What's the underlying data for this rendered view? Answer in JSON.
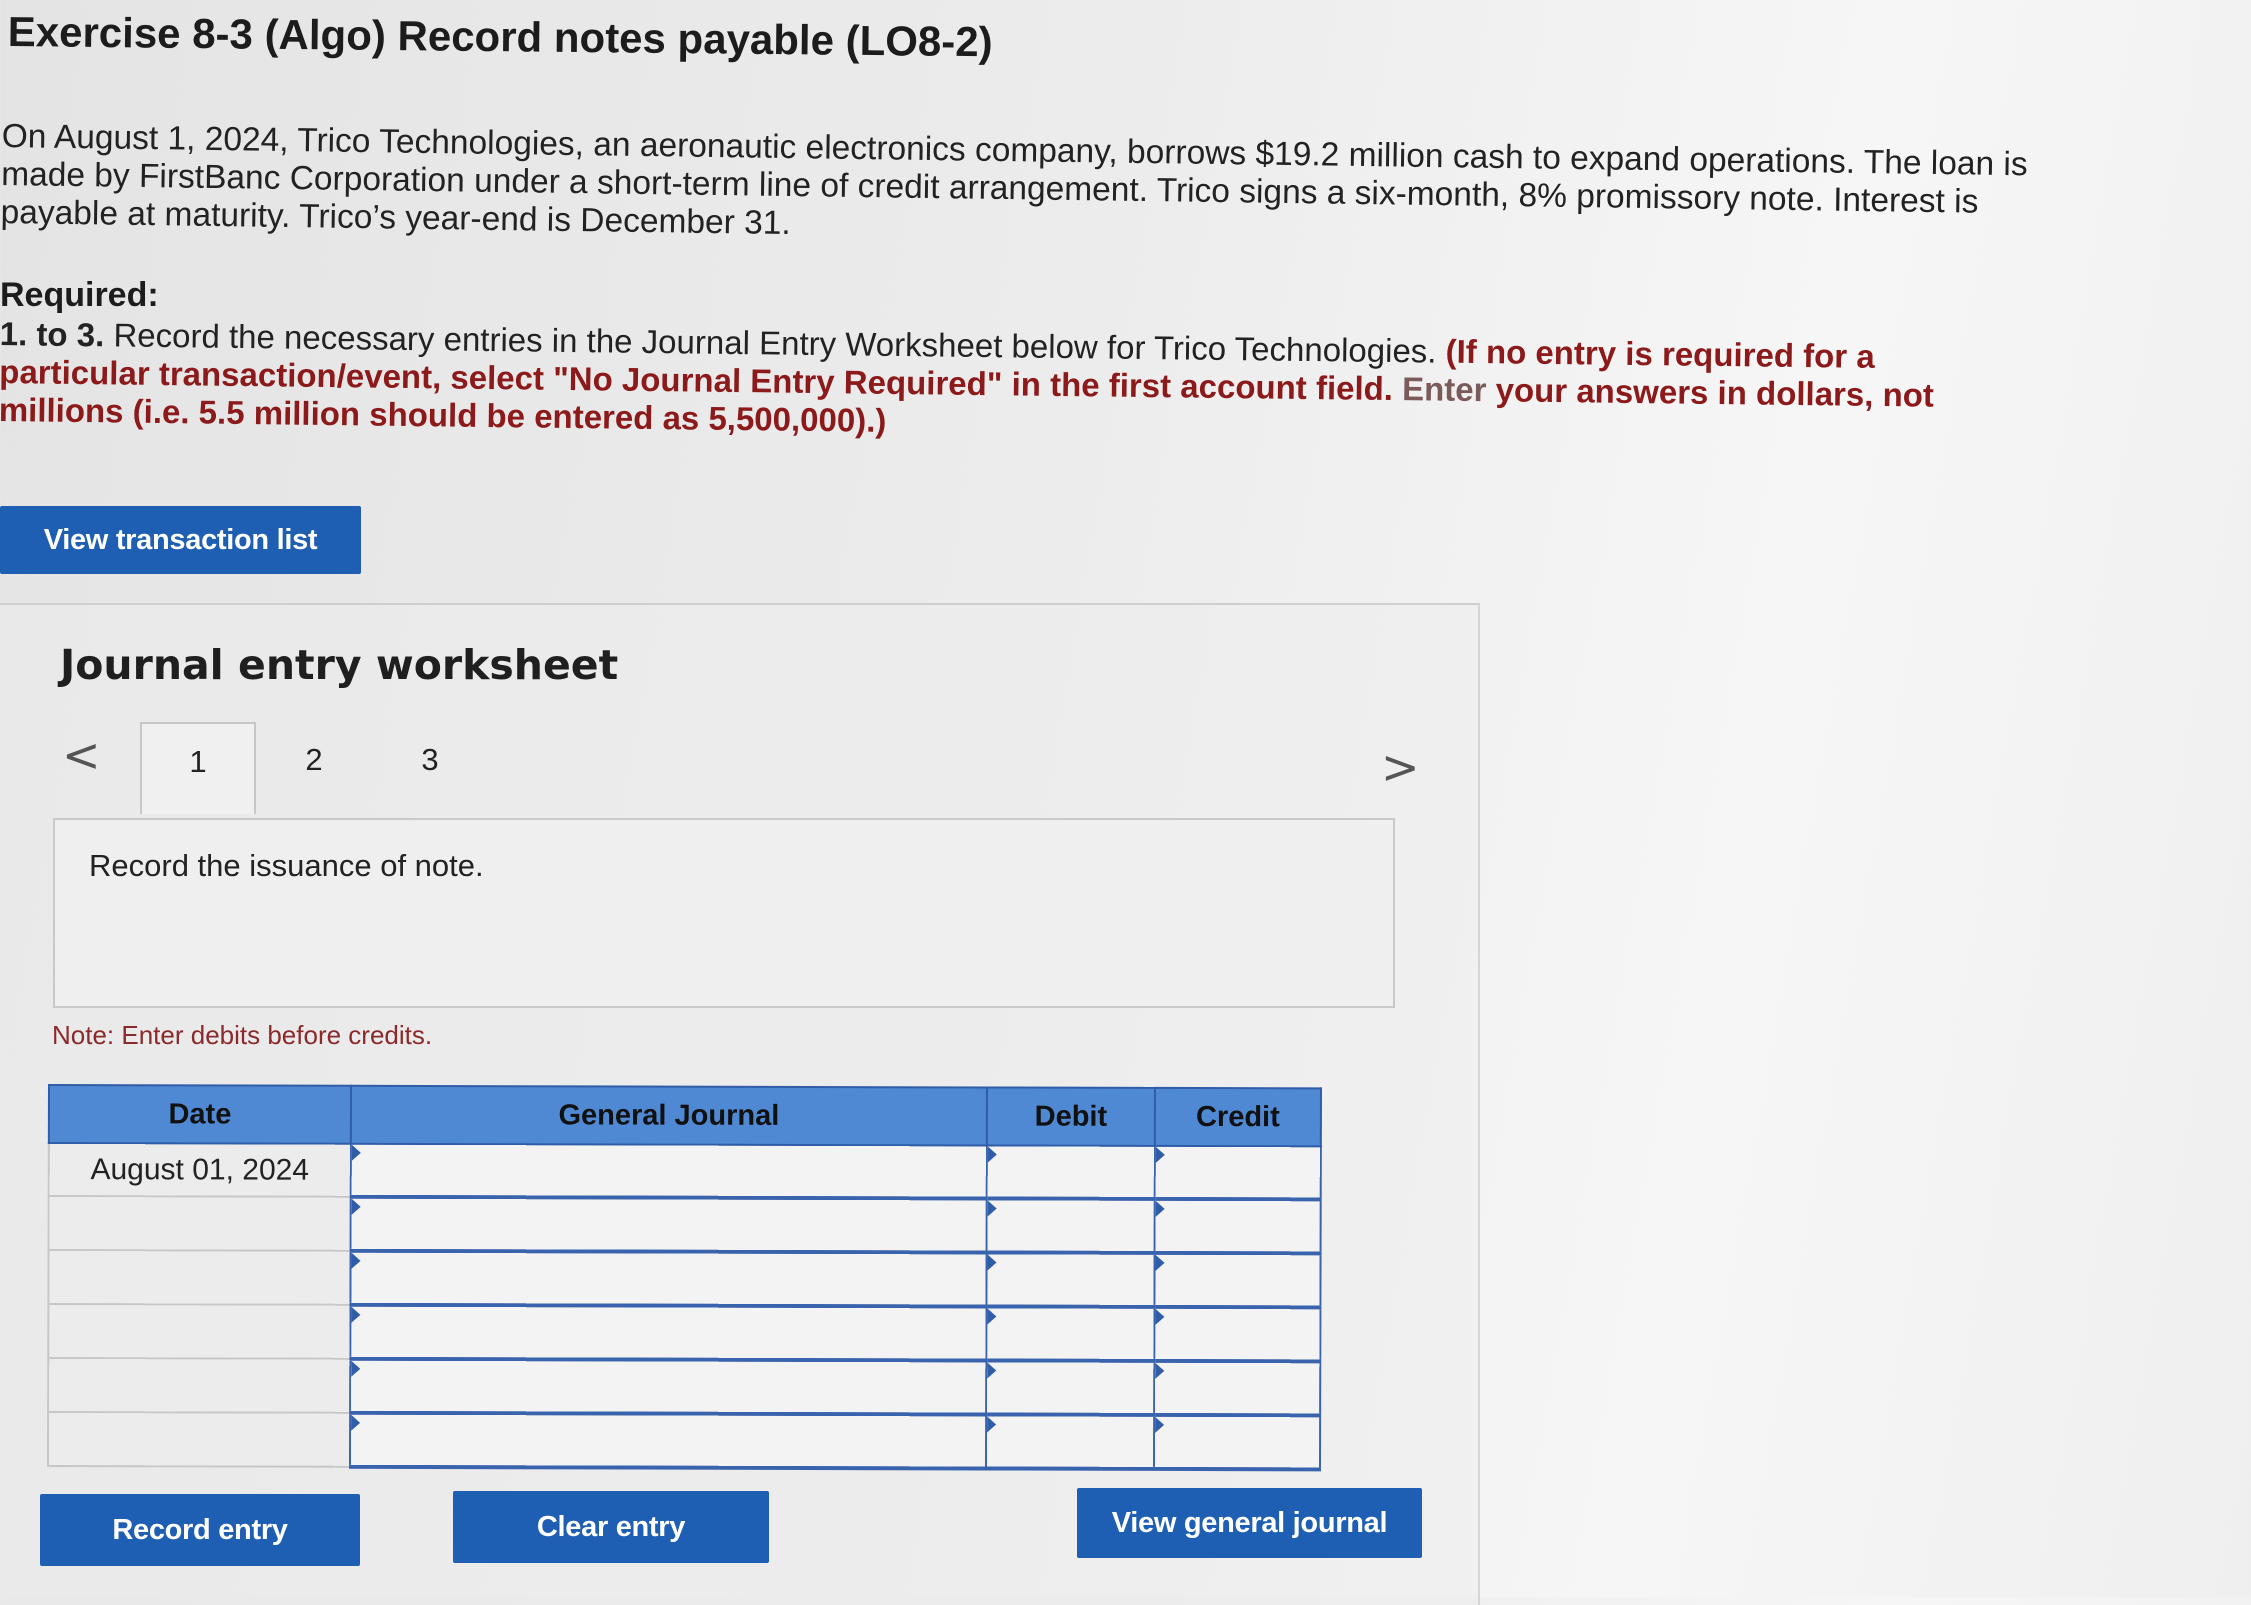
{
  "page": {
    "title": "Exercise 8-3 (Algo) Record notes payable (LO8-2)",
    "problem_text": "On August 1, 2024, Trico Technologies, an aeronautic electronics company, borrows $19.2 million cash to expand operations. The loan is made by FirstBanc Corporation under a short-term line of credit arrangement. Trico signs a six-month, 8% promissory note. Interest is payable at maturity. Trico’s year-end is December 31.",
    "required_label": "Required:",
    "instructions": {
      "prefix_bold": "1. to 3.",
      "main": " Record the necessary entries in the Journal Entry Worksheet below for Trico Technologies. ",
      "red": "(If no entry is required for a particular transaction/event, select \"No Journal Entry Required\" in the first account field. ",
      "faded": "Enter",
      "red_tail": " your answers in dollars, not millions (i.e. 5.5 million should be entered as 5,500,000).)"
    }
  },
  "buttons": {
    "view_transaction_list": "View transaction list",
    "record_entry": "Record entry",
    "clear_entry": "Clear entry",
    "view_general_journal": "View general journal"
  },
  "worksheet": {
    "heading": "Journal entry worksheet",
    "nav_prev": "<",
    "nav_next": ">",
    "tabs": [
      "1",
      "2",
      "3"
    ],
    "active_tab": "1",
    "task_text": "Record the issuance of note.",
    "note": "Note: Enter debits before credits.",
    "table": {
      "headers": [
        "Date",
        "General Journal",
        "Debit",
        "Credit"
      ],
      "rows": [
        {
          "date": "August 01, 2024",
          "account": "",
          "debit": "",
          "credit": ""
        },
        {
          "date": "",
          "account": "",
          "debit": "",
          "credit": ""
        },
        {
          "date": "",
          "account": "",
          "debit": "",
          "credit": ""
        },
        {
          "date": "",
          "account": "",
          "debit": "",
          "credit": ""
        },
        {
          "date": "",
          "account": "",
          "debit": "",
          "credit": ""
        },
        {
          "date": "",
          "account": "",
          "debit": "",
          "credit": ""
        }
      ]
    }
  },
  "colors": {
    "button_blue": "#1f5fb3",
    "header_blue": "#4f88d3",
    "instruction_red": "#8c1a1a"
  }
}
